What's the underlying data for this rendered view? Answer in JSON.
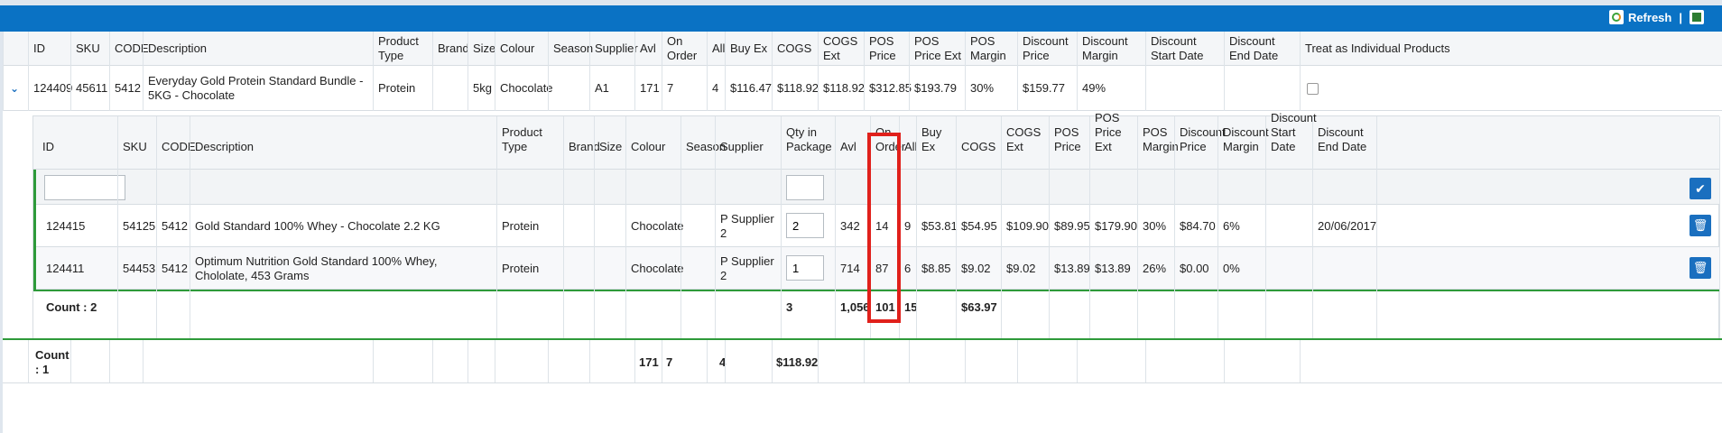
{
  "toolbar": {
    "refresh_label": "Refresh",
    "separator": "|"
  },
  "outer": {
    "headers": [
      "ID",
      "SKU",
      "CODE",
      "Description",
      "Product Type",
      "Brand",
      "Size",
      "Colour",
      "Season",
      "Supplier",
      "Avl",
      "On Order",
      "All",
      "Buy Ex",
      "COGS",
      "COGS Ext",
      "POS Price",
      "POS Price Ext",
      "POS Margin",
      "Discount Price",
      "Discount Margin",
      "Discount Start Date",
      "Discount End Date",
      "Treat as Individual Products"
    ],
    "row": [
      "124409",
      "45611",
      "5412",
      "Everyday Gold Protein Standard Bundle - 5KG - Chocolate",
      "Protein",
      "",
      "5kg",
      "Chocolate",
      "",
      "A1",
      "171",
      "7",
      "4",
      "$116.47",
      "$118.92",
      "$118.92",
      "$312.85",
      "$193.79",
      "30%",
      "$159.77",
      "49%",
      "",
      "",
      ""
    ],
    "footer": {
      "count_label": "Count : 1",
      "avl": "171",
      "on_order": "7",
      "all": "4",
      "cogs": "$118.92"
    }
  },
  "inner": {
    "headers": [
      "ID",
      "SKU",
      "CODE",
      "Description",
      "Product Type",
      "Brand",
      "Size",
      "Colour",
      "Season",
      "Supplier",
      "Qty in Package",
      "Avl",
      "On Order",
      "All",
      "Buy Ex",
      "COGS",
      "COGS Ext",
      "POS Price",
      "POS Price Ext",
      "POS Margin",
      "Discount Price",
      "Discount Margin",
      "Discount Start Date",
      "Discount End Date"
    ],
    "rows": [
      [
        "124415",
        "54125",
        "5412",
        "Gold Standard 100% Whey - Chocolate 2.2 KG",
        "Protein",
        "",
        "",
        "Chocolate",
        "",
        "P Supplier 2",
        "2",
        "342",
        "14",
        "9",
        "$53.81",
        "$54.95",
        "$109.90",
        "$89.95",
        "$179.90",
        "30%",
        "$84.70",
        "6%",
        "",
        "20/06/2017"
      ],
      [
        "124411",
        "54453",
        "5412",
        "Optimum Nutrition Gold Standard 100% Whey, Chololate, 453 Grams",
        "Protein",
        "",
        "",
        "Chocolate",
        "",
        "P Supplier 2",
        "1",
        "714",
        "87",
        "6",
        "$8.85",
        "$9.02",
        "$9.02",
        "$13.89",
        "$13.89",
        "26%",
        "$0.00",
        "0%",
        "",
        ""
      ]
    ],
    "footer": {
      "count_label": "Count : 2",
      "qty": "3",
      "avl": "1,056",
      "on_order": "101",
      "all": "15",
      "cogs": "$63.97"
    }
  },
  "colors": {
    "header_bar": "#0a72c4",
    "highlight": "#e0201b",
    "row_accent": "#2e9a3a",
    "button": "#1a6fbf"
  }
}
